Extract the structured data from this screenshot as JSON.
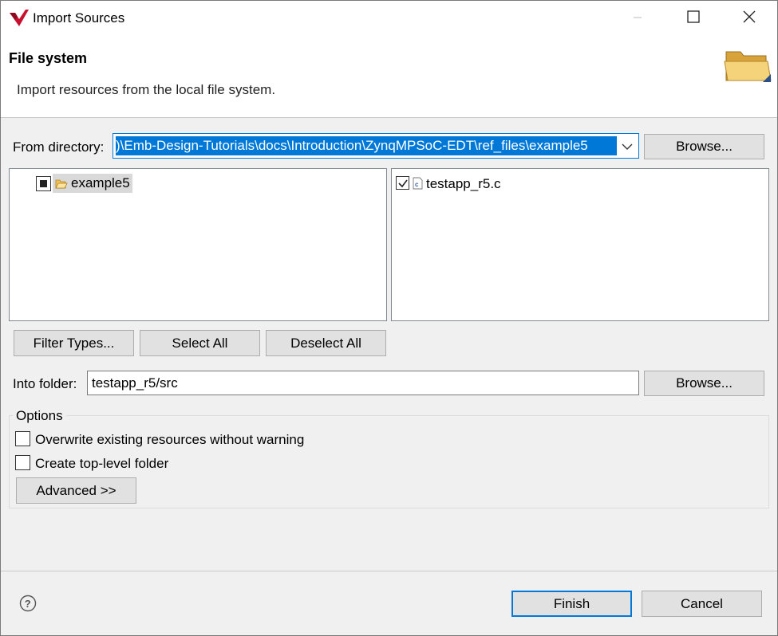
{
  "window": {
    "title": "Import Sources",
    "logo_icon": "xilinx-logo-icon"
  },
  "header": {
    "title": "File system",
    "description": "Import resources from the local file system.",
    "icon": "open-folder-icon"
  },
  "from_directory": {
    "label": "From directory:",
    "value": ")\\Emb-Design-Tutorials\\docs\\Introduction\\ZynqMPSoC-EDT\\ref_files\\example5",
    "browse_label": "Browse..."
  },
  "folder_tree": {
    "items": [
      {
        "label": "example5",
        "state": "partial"
      }
    ]
  },
  "file_list": {
    "items": [
      {
        "label": "testapp_r5.c",
        "checked": true
      }
    ]
  },
  "selection_buttons": {
    "filter_types": "Filter Types...",
    "select_all": "Select All",
    "deselect_all": "Deselect All"
  },
  "into_folder": {
    "label": "Into folder:",
    "value": "testapp_r5/src",
    "browse_label": "Browse..."
  },
  "options": {
    "title": "Options",
    "overwrite_label": "Overwrite existing resources without warning",
    "overwrite_checked": false,
    "top_level_label": "Create top-level folder",
    "top_level_checked": false,
    "advanced_label": "Advanced >>"
  },
  "footer": {
    "finish_label": "Finish",
    "cancel_label": "Cancel"
  },
  "colors": {
    "accent": "#0078d7",
    "window_bg": "#f0f0f0",
    "folder": "#e8b84a"
  }
}
